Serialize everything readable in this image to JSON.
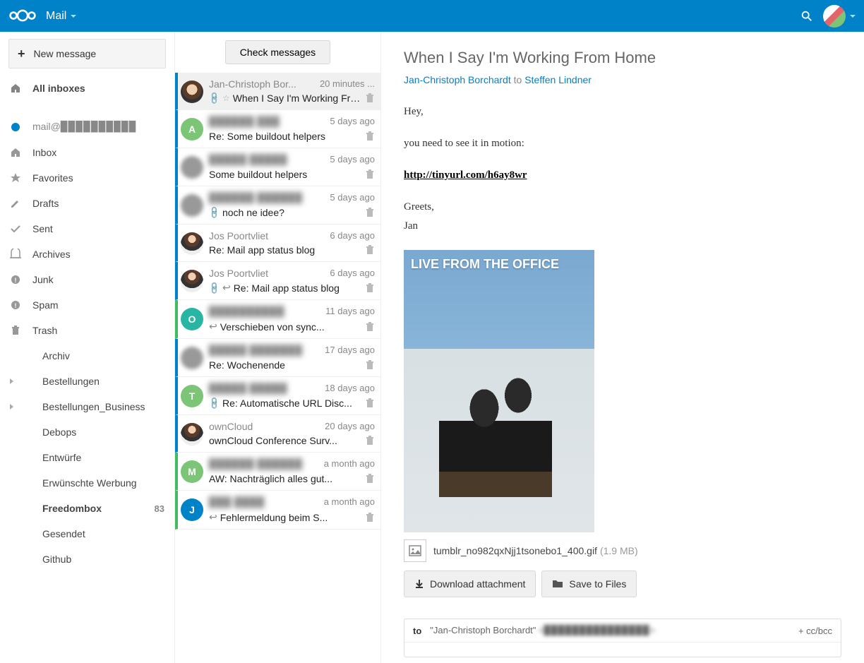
{
  "header": {
    "app_name": "Mail"
  },
  "sidebar": {
    "new_message": "New message",
    "all_inboxes": "All inboxes",
    "account": "mail@▉▉▉▉▉▉▉▉▉▉",
    "folders": [
      {
        "label": "Inbox",
        "icon": "🏠"
      },
      {
        "label": "Favorites",
        "icon": "★"
      },
      {
        "label": "Drafts",
        "icon": "✎"
      },
      {
        "label": "Sent",
        "icon": "✓"
      },
      {
        "label": "Archives",
        "icon": "⌂"
      },
      {
        "label": "Junk",
        "icon": "⊘"
      },
      {
        "label": "Spam",
        "icon": "⊘"
      },
      {
        "label": "Trash",
        "icon": "🗑"
      }
    ],
    "custom_folders": [
      {
        "label": "Archiv",
        "expandable": false
      },
      {
        "label": "Bestellungen",
        "expandable": true
      },
      {
        "label": "Bestellungen_Business",
        "expandable": true
      },
      {
        "label": "Debops",
        "expandable": false
      },
      {
        "label": "Entwürfe",
        "expandable": false
      },
      {
        "label": "Erwünschte Werbung",
        "expandable": false
      },
      {
        "label": "Freedombox",
        "expandable": false,
        "bold": true,
        "count": "83"
      },
      {
        "label": "Gesendet",
        "expandable": false
      },
      {
        "label": "Github",
        "expandable": false
      }
    ]
  },
  "msglist": {
    "check_button": "Check messages",
    "items": [
      {
        "sender": "Jan-Christoph Bor...",
        "time": "20 minutes ...",
        "subject": "When I Say I'm Working Fro...",
        "avatar_class": "img-jc",
        "unread": true,
        "selected": true,
        "attachment": true,
        "star": true
      },
      {
        "sender": "▉▉▉▉▉▉ ▉▉▉",
        "time": "5 days ago",
        "subject": "Re: Some buildout helpers",
        "avatar_class": "letter-A",
        "avatar_letter": "A",
        "unread": true,
        "sender_blur": true
      },
      {
        "sender": "▉▉▉▉▉ ▉▉▉▉▉",
        "time": "5 days ago",
        "subject": "Some buildout helpers",
        "avatar_class": "blur",
        "unread": true,
        "sender_blur": true
      },
      {
        "sender": "▉▉▉▉▉▉ ▉▉▉▉▉▉",
        "time": "5 days ago",
        "subject": "noch ne idee?",
        "avatar_class": "blur",
        "unread": true,
        "attachment": true,
        "sender_blur": true
      },
      {
        "sender": "Jos Poortvliet",
        "time": "6 days ago",
        "subject": "Re: Mail app status blog",
        "avatar_class": "img-jos",
        "unread": true
      },
      {
        "sender": "Jos Poortvliet",
        "time": "6 days ago",
        "subject": "Re: Mail app status blog",
        "avatar_class": "img-jos",
        "unread": true,
        "attachment": true,
        "replied": true
      },
      {
        "sender": "▉▉▉▉▉▉▉▉▉▉",
        "time": "11 days ago",
        "subject": "Verschieben von sync...",
        "avatar_class": "letter-O",
        "avatar_letter": "O",
        "unread_green": true,
        "replied": true,
        "sender_blur": true
      },
      {
        "sender": "▉▉▉▉▉ ▉▉▉▉▉▉▉",
        "time": "17 days ago",
        "subject": "Re: Wochenende",
        "avatar_class": "blur",
        "unread": true,
        "sender_blur": true
      },
      {
        "sender": "▉▉▉▉▉ ▉▉▉▉▉",
        "time": "18 days ago",
        "subject": "Re: Automatische URL Disc...",
        "avatar_class": "letter-T",
        "avatar_letter": "T",
        "unread": true,
        "attachment": true,
        "sender_blur": true
      },
      {
        "sender": "ownCloud",
        "time": "20 days ago",
        "subject": "ownCloud Conference Surv...",
        "avatar_class": "img-jos",
        "unread": true
      },
      {
        "sender": "▉▉▉▉▉▉ ▉▉▉▉▉▉",
        "time": "a month ago",
        "subject": "AW: Nachträglich alles gut...",
        "avatar_class": "letter-M",
        "avatar_letter": "M",
        "unread_green": true,
        "sender_blur": true
      },
      {
        "sender": "▉▉▉ ▉▉▉▉",
        "time": "a month ago",
        "subject": "Fehlermeldung beim S...",
        "avatar_class": "letter-J",
        "avatar_letter": "J",
        "unread_green": true,
        "replied": true,
        "sender_blur": true
      }
    ]
  },
  "reader": {
    "subject": "When I Say I'm Working From Home",
    "from": "Jan-Christoph Borchardt",
    "to_label": "to",
    "to": "Steffen Lindner",
    "body_lines": [
      "Hey,",
      "you need to see it in motion:",
      "http://tinyurl.com/h6ay8wr",
      "Greets,",
      "Jan"
    ],
    "attachment_overlay": "LIVE FROM THE OFFICE",
    "attachment_name": "tumblr_no982qxNjj1tsonebo1_400.gif",
    "attachment_size": "(1.9 MB)",
    "download_label": "Download attachment",
    "save_label": "Save to Files",
    "reply": {
      "to_label": "to",
      "to_name": "\"Jan-Christoph Borchardt\"",
      "to_addr": "<▉▉▉▉▉▉▉▉▉▉▉▉▉▉▉>",
      "cc": "+ cc/bcc"
    }
  }
}
